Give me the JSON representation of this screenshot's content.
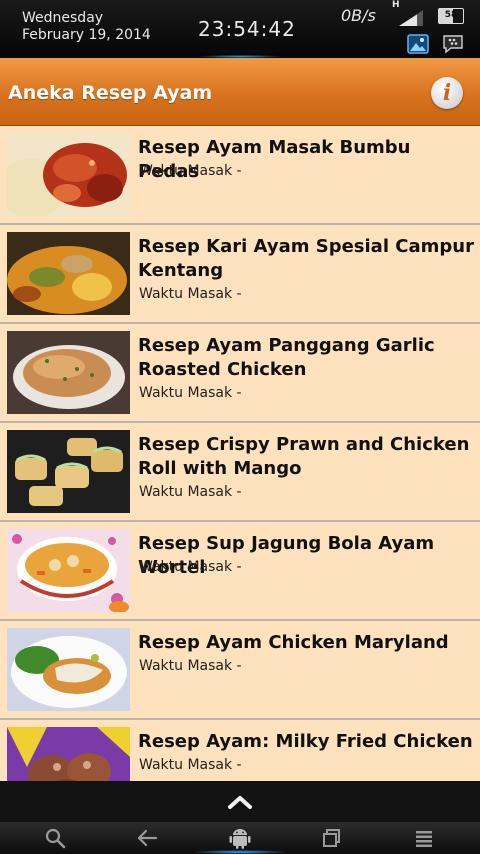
{
  "status": {
    "day": "Wednesday",
    "date": "February 19, 2014",
    "time": "23:54:42",
    "network_speed": "0B/s",
    "network_type": "H",
    "battery": "58"
  },
  "app": {
    "title": "Aneka Resep Ayam"
  },
  "recipes": [
    {
      "title": "Resep Ayam Masak Bumbu Pedas",
      "subtitle": "Waktu Masak -"
    },
    {
      "title": "Resep Kari Ayam Spesial Campur Kentang",
      "subtitle": "Waktu Masak -"
    },
    {
      "title": "Resep Ayam Panggang Garlic Roasted Chicken",
      "subtitle": "Waktu Masak -"
    },
    {
      "title": "Resep Crispy Prawn and Chicken Roll with Mango",
      "subtitle": "Waktu Masak -"
    },
    {
      "title": "Resep Sup Jagung Bola Ayam Wortel",
      "subtitle": "Waktu Masak -"
    },
    {
      "title": "Resep Ayam Chicken Maryland",
      "subtitle": "Waktu Masak -"
    },
    {
      "title": "Resep Ayam: Milky Fried Chicken",
      "subtitle": "Waktu Masak -"
    }
  ],
  "colors": {
    "title_bar": "#d8731f",
    "list_background": "#fde2bd",
    "accent_glow": "#2aa3ff"
  },
  "icons": {
    "gallery": "picture-icon",
    "bbm": "chat-icon",
    "info": "info-icon",
    "chevron": "chevron-up-icon",
    "nav": [
      "search-icon",
      "back-icon",
      "android-home-icon",
      "recent-apps-icon",
      "menu-icon"
    ]
  }
}
